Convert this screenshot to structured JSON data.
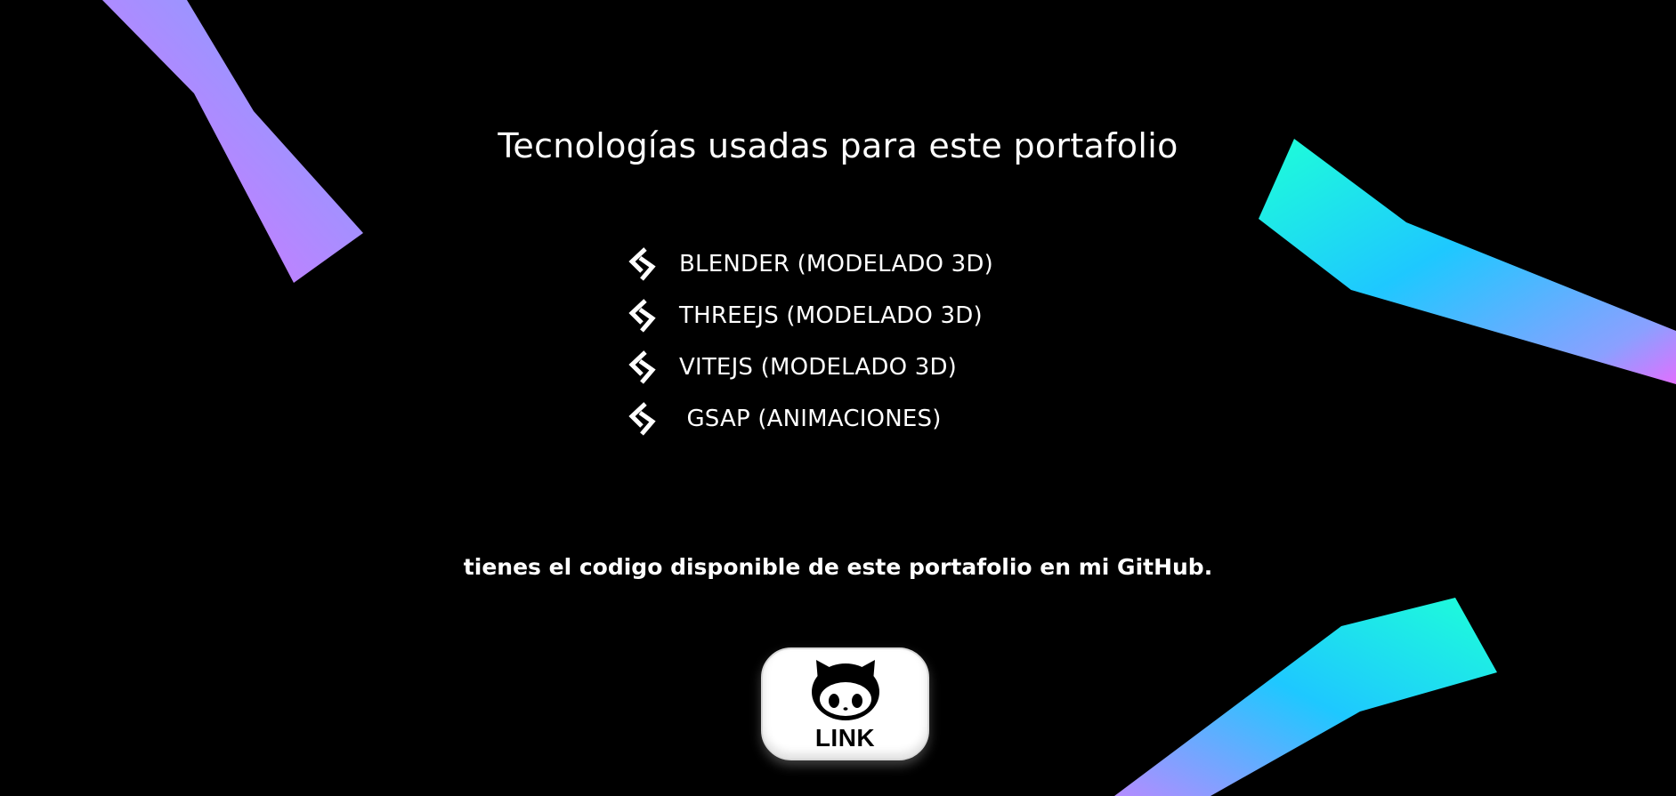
{
  "page": {
    "heading": "Tecnologías usadas para este portafolio",
    "technologies": [
      {
        "label": "BLENDER (MODELADO 3D)",
        "icon": "chevrons-icon"
      },
      {
        "label": "THREEJS (MODELADO 3D)",
        "icon": "chevrons-icon"
      },
      {
        "label": "VITEJS (MODELADO 3D)",
        "icon": "chevrons-icon"
      },
      {
        "label": " GSAP (ANIMACIONES)",
        "icon": "chevrons-icon"
      }
    ],
    "note": "tienes el codigo disponible de este portafolio en mi GitHub.",
    "github_button": {
      "label": "LINK",
      "icon": "github-octocat-icon"
    }
  },
  "colors": {
    "background": "#000000",
    "text": "#ffffff",
    "gradient_pink": "#e070ff",
    "gradient_blue": "#1ec8ff",
    "gradient_cyan": "#1effd8"
  }
}
